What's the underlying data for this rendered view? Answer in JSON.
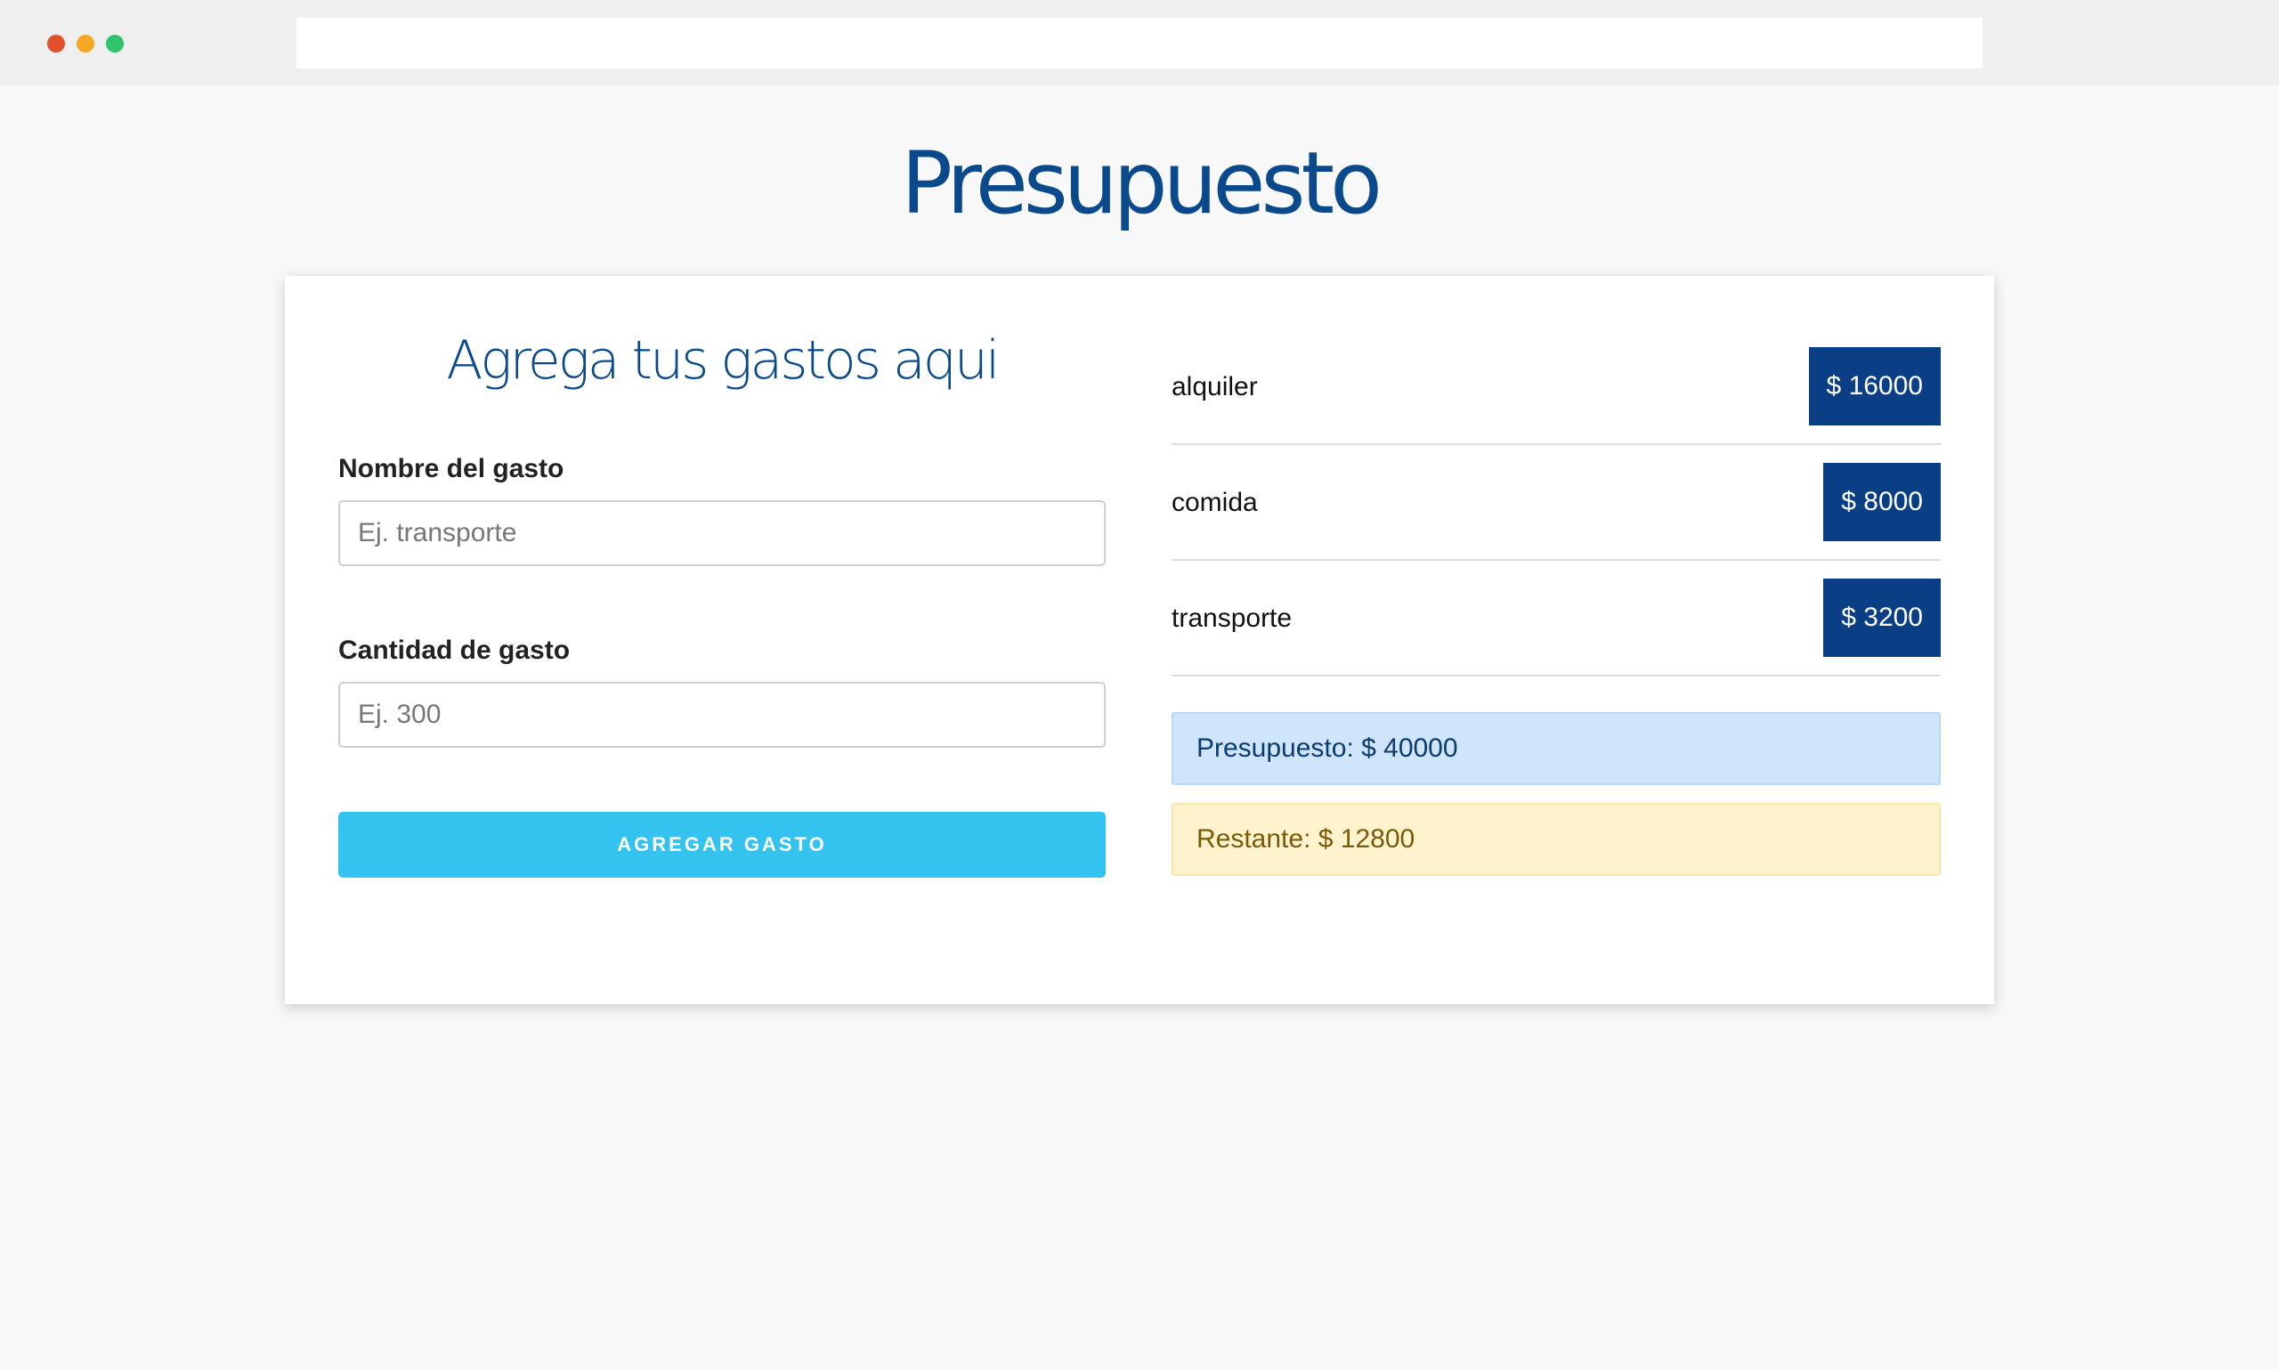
{
  "header": {
    "title": "Presupuesto"
  },
  "form": {
    "heading": "Agrega tus gastos aqui",
    "name_label": "Nombre del gasto",
    "name_placeholder": "Ej. transporte",
    "amount_label": "Cantidad de gasto",
    "amount_placeholder": "Ej. 300",
    "submit_label": "Agregar gasto"
  },
  "expenses": [
    {
      "name": "alquiler",
      "amount": "$ 16000"
    },
    {
      "name": "comida",
      "amount": "$ 8000"
    },
    {
      "name": "transporte",
      "amount": "$ 3200"
    }
  ],
  "summary": {
    "budget": "Presupuesto: $ 40000",
    "remaining": "Restante: $ 12800"
  },
  "colors": {
    "primary": "#0a4a8c",
    "badge": "#0a3f86",
    "button": "#33c3ee",
    "budget_bg": "#cfe5fc",
    "remaining_bg": "#fff3cd"
  }
}
